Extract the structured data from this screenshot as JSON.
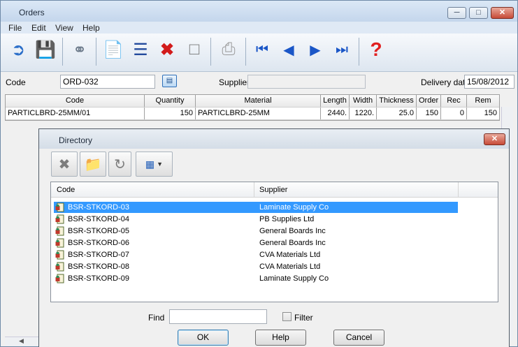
{
  "window": {
    "title": "Orders"
  },
  "menu": [
    "File",
    "Edit",
    "View",
    "Help"
  ],
  "toolbar": {
    "icons": [
      "exit-icon",
      "save-icon",
      "find-icon",
      "copy-icon",
      "insert-line-icon",
      "delete-icon",
      "new-icon",
      "print-icon",
      "first-icon",
      "previous-icon",
      "next-icon",
      "last-icon",
      "help-icon"
    ]
  },
  "form": {
    "code_label": "Code",
    "code_value": "ORD-032",
    "supplier_label": "Supplier",
    "supplier_value": "",
    "delivery_label": "Delivery date",
    "delivery_value": "15/08/2012"
  },
  "grid": {
    "columns": [
      "Code",
      "Quantity",
      "Material",
      "Length",
      "Width",
      "Thickness",
      "Order",
      "Rec",
      "Rem"
    ],
    "rows": [
      [
        "PARTICLBRD-25MM/01",
        "150",
        "PARTICLBRD-25MM",
        "2440.",
        "1220.",
        "25.0",
        "150",
        "0",
        "150"
      ]
    ]
  },
  "dialog": {
    "title": "Directory",
    "columns": [
      "Code",
      "Supplier"
    ],
    "items": [
      {
        "code": "BSR-STKORD-03",
        "supplier": "Laminate Supply Co"
      },
      {
        "code": "BSR-STKORD-04",
        "supplier": "PB Supplies Ltd"
      },
      {
        "code": "BSR-STKORD-05",
        "supplier": "General Boards Inc"
      },
      {
        "code": "BSR-STKORD-06",
        "supplier": "General Boards Inc"
      },
      {
        "code": "BSR-STKORD-07",
        "supplier": "CVA Materials Ltd"
      },
      {
        "code": "BSR-STKORD-08",
        "supplier": "CVA Materials Ltd"
      },
      {
        "code": "BSR-STKORD-09",
        "supplier": "Laminate Supply Co"
      }
    ],
    "selected_index": 0,
    "find_label": "Find",
    "find_value": "",
    "filter_label": "Filter",
    "ok": "OK",
    "help": "Help",
    "cancel": "Cancel"
  },
  "colors": {
    "selection": "#3399ff",
    "close": "#c74a37"
  }
}
